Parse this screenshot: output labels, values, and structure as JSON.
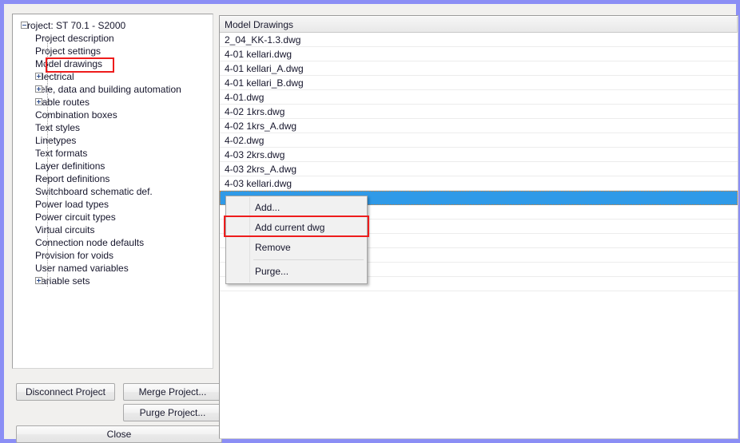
{
  "window": {
    "border_color": "#8b8ef5",
    "background": "#f1f0ee"
  },
  "tree": {
    "nodes": [
      {
        "label": "Project: ST 70.1 - S2000",
        "level": 0,
        "expander": "minus",
        "highlighted": false
      },
      {
        "label": "Project description",
        "level": 1,
        "expander": "none",
        "highlighted": false
      },
      {
        "label": "Project settings",
        "level": 1,
        "expander": "none",
        "highlighted": false
      },
      {
        "label": "Model drawings",
        "level": 1,
        "expander": "none",
        "highlighted": true
      },
      {
        "label": "Electrical",
        "level": 1,
        "expander": "plus",
        "highlighted": false
      },
      {
        "label": "Tele, data and building automation",
        "level": 1,
        "expander": "plus",
        "highlighted": false
      },
      {
        "label": "Cable routes",
        "level": 1,
        "expander": "plus",
        "highlighted": false
      },
      {
        "label": "Combination boxes",
        "level": 1,
        "expander": "none",
        "highlighted": false
      },
      {
        "label": "Text styles",
        "level": 1,
        "expander": "none",
        "highlighted": false
      },
      {
        "label": "Linetypes",
        "level": 1,
        "expander": "none",
        "highlighted": false
      },
      {
        "label": "Text formats",
        "level": 1,
        "expander": "none",
        "highlighted": false
      },
      {
        "label": "Layer definitions",
        "level": 1,
        "expander": "none",
        "highlighted": false
      },
      {
        "label": "Report definitions",
        "level": 1,
        "expander": "none",
        "highlighted": false
      },
      {
        "label": "Switchboard schematic def.",
        "level": 1,
        "expander": "none",
        "highlighted": false
      },
      {
        "label": "Power load types",
        "level": 1,
        "expander": "none",
        "highlighted": false
      },
      {
        "label": "Power circuit types",
        "level": 1,
        "expander": "none",
        "highlighted": false
      },
      {
        "label": "Virtual circuits",
        "level": 1,
        "expander": "none",
        "highlighted": false
      },
      {
        "label": "Connection node defaults",
        "level": 1,
        "expander": "none",
        "highlighted": false
      },
      {
        "label": "Provision for voids",
        "level": 1,
        "expander": "none",
        "highlighted": false
      },
      {
        "label": "User named variables",
        "level": 1,
        "expander": "none",
        "highlighted": false
      },
      {
        "label": "Variable sets",
        "level": 1,
        "expander": "plus",
        "highlighted": false
      }
    ]
  },
  "buttons": {
    "disconnect_project": "Disconnect Project",
    "merge_project": "Merge Project...",
    "purge_project": "Purge Project...",
    "close": "Close"
  },
  "list": {
    "header": "Model Drawings",
    "rows": [
      {
        "label": "2_04_KK-1.3.dwg",
        "selected": false
      },
      {
        "label": "4-01 kellari.dwg",
        "selected": false
      },
      {
        "label": "4-01 kellari_A.dwg",
        "selected": false
      },
      {
        "label": "4-01 kellari_B.dwg",
        "selected": false
      },
      {
        "label": "4-01.dwg",
        "selected": false
      },
      {
        "label": "4-02 1krs.dwg",
        "selected": false
      },
      {
        "label": "4-02 1krs_A.dwg",
        "selected": false
      },
      {
        "label": "4-02.dwg",
        "selected": false
      },
      {
        "label": "4-03 2krs.dwg",
        "selected": false
      },
      {
        "label": "4-03 2krs_A.dwg",
        "selected": false
      },
      {
        "label": "4-03 kellari.dwg",
        "selected": false
      },
      {
        "label": "",
        "selected": true
      },
      {
        "label": "",
        "selected": false
      },
      {
        "label": "",
        "selected": false
      },
      {
        "label": "",
        "selected": false
      },
      {
        "label": "",
        "selected": false
      },
      {
        "label": "",
        "selected": false
      },
      {
        "label": "",
        "selected": false
      }
    ],
    "selection_color": "#2f9ae8"
  },
  "context_menu": {
    "items": [
      {
        "label": "Add...",
        "separator_after": false,
        "highlighted": false
      },
      {
        "label": "Add current dwg",
        "separator_after": false,
        "highlighted": true
      },
      {
        "label": "Remove",
        "separator_after": true,
        "highlighted": false
      },
      {
        "label": "Purge...",
        "separator_after": false,
        "highlighted": false
      }
    ]
  },
  "annotations": {
    "highlight_color": "#ee1c1c",
    "targets": [
      "Model drawings",
      "Add current dwg"
    ]
  }
}
